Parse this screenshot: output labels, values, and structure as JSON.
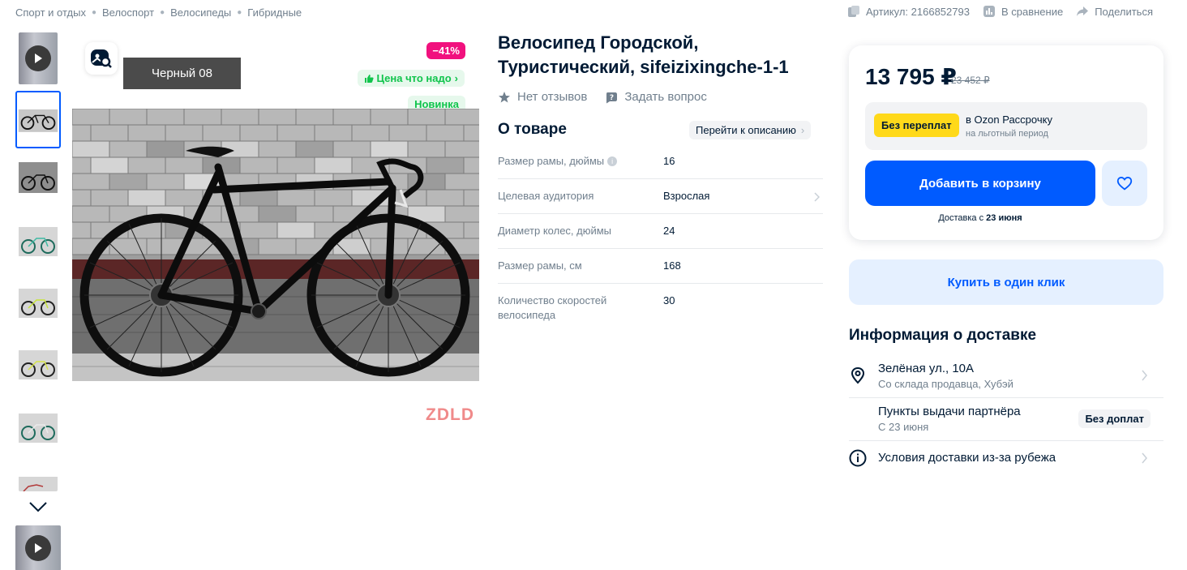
{
  "breadcrumb": [
    "Спорт и отдых",
    "Велоспорт",
    "Велосипеды",
    "Гибридные"
  ],
  "top_actions": {
    "sku": "Артикул: 2166852793",
    "compare": "В сравнение",
    "share": "Поделиться"
  },
  "gallery": {
    "color_tooltip": "Черный  08",
    "discount": "−41%",
    "deal_tag": "Цена что надо",
    "new_tag": "Новинка",
    "brand": "ZDLD",
    "thumbnails": [
      "video",
      "image",
      "image",
      "image",
      "image",
      "image",
      "image",
      "image",
      "video"
    ],
    "active_thumbnail": 1
  },
  "product": {
    "title": "Велосипед Городской, Туристический, sifeizixingche-1-1",
    "reviews": "Нет отзывов",
    "ask": "Задать вопрос",
    "about_title": "О товаре",
    "to_description": "Перейти к описанию",
    "specs": [
      {
        "name": "Размер рамы, дюймы",
        "value": "16"
      },
      {
        "name": "Целевая аудитория",
        "value": "Взрослая"
      },
      {
        "name": "Диаметр колес, дюймы",
        "value": "24"
      },
      {
        "name": "Размер рамы, см",
        "value": "168"
      },
      {
        "name": "Количество скоростей велосипеда",
        "value": "30"
      }
    ]
  },
  "buy": {
    "price": "13 795 ₽",
    "old_price": "23 452 ₽",
    "installment_badge": "Без переплат",
    "installment_title": "в Ozon Рассрочку",
    "installment_sub": "на льготный период",
    "add_to_cart": "Добавить в корзину",
    "delivery_prefix": "Доставка с",
    "delivery_date": "23 июня",
    "one_click": "Купить в один клик"
  },
  "delivery": {
    "title": "Информация о доставке",
    "address": "Зелёная ул., 10А",
    "address_sub": "Со склада продавца, Хубэй",
    "pickup": "Пункты выдачи партнёра",
    "pickup_sub": "С 23 июня",
    "pickup_badge": "Без доплат",
    "abroad": "Условия доставки из-за рубежа"
  },
  "colors": {
    "accent": "#005bff",
    "discount": "#f1117e",
    "green": "#10c44c",
    "yellow": "#ffd91a"
  }
}
